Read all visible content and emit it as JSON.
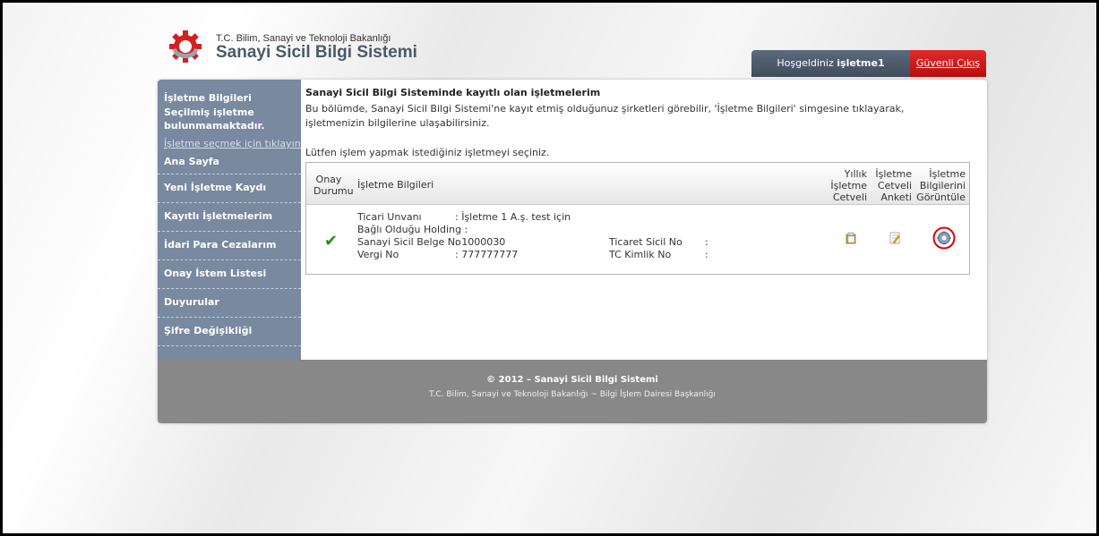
{
  "header": {
    "ministry": "T.C. Bilim, Sanayi ve Teknoloji Bakanlığı",
    "system_title": "Sanayi Sicil Bilgi Sistemi",
    "welcome_prefix": "Hoşgeldiniz",
    "username": "işletme1",
    "logout_label": "Güvenli Çıkış",
    "logo_icon": "gear-logo-icon"
  },
  "sidebar": {
    "title": "İşletme Bilgileri",
    "message": "Seçilmiş işletme bulunmamaktadır.",
    "select_link": "İşletme seçmek için tıklayınız.",
    "items": [
      {
        "label": "Ana Sayfa"
      },
      {
        "label": "Yeni İşletme Kaydı"
      },
      {
        "label": "Kayıtlı İşletmelerim"
      },
      {
        "label": "İdari Para Cezalarım"
      },
      {
        "label": "Onay İstem Listesi"
      },
      {
        "label": "Duyurular"
      },
      {
        "label": "Şifre Değişikliği"
      }
    ]
  },
  "main": {
    "title": "Sanayi Sicil Bilgi Sisteminde kayıtlı olan işletmelerim",
    "description": "Bu bölümde, Sanayi Sicil Bilgi Sistemi'ne kayıt etmiş olduğunuz şirketleri görebilir, 'İşletme Bilgileri' simgesine tıklayarak, işletmenizin bilgilerine ulaşabilirsiniz.",
    "instruction": "Lütfen işlem yapmak istediğiniz işletmeyi seçiniz.",
    "table": {
      "headers": {
        "approval": [
          "Onay",
          "Durumu"
        ],
        "info": "İşletme Bilgileri",
        "annual": [
          "Yıllık",
          "İşletme",
          "Cetveli"
        ],
        "survey": [
          "İşletme",
          "Cetveli",
          "Anketi"
        ],
        "view": [
          "İşletme",
          "Bilgilerini",
          "Görüntüle"
        ]
      },
      "row": {
        "status_icon": "check-icon",
        "trade_name_label": "Ticari Unvanı",
        "trade_name_value": ": İşletme 1 A.ş. test için",
        "holding_label": "Bağlı Olduğu Holding :",
        "cert_label": "Sanayi Sicil Belge No",
        "cert_value": ": 1000030",
        "tax_label": "Vergi No",
        "tax_value": ": 777777777",
        "trade_reg_label": "Ticaret Sicil No",
        "trade_reg_value": ":",
        "tc_label": "TC Kimlik No",
        "tc_value": ":",
        "annual_icon": "clipboard-icon",
        "survey_icon": "edit-document-icon",
        "view_icon": "gear-view-icon"
      }
    }
  },
  "footer": {
    "copyright": "© 2012 – Sanayi Sicil Bilgi Sistemi",
    "department": "T.C. Bilim, Sanayi ve Teknoloji Bakanlığı ~ Bilgi İşlem Dairesi Başkanlığı"
  },
  "colors": {
    "sidebar_bg": "#7889a0",
    "logout_red": "#c81b1b",
    "footer_bg": "#888888",
    "highlight_circle": "#e00000"
  }
}
